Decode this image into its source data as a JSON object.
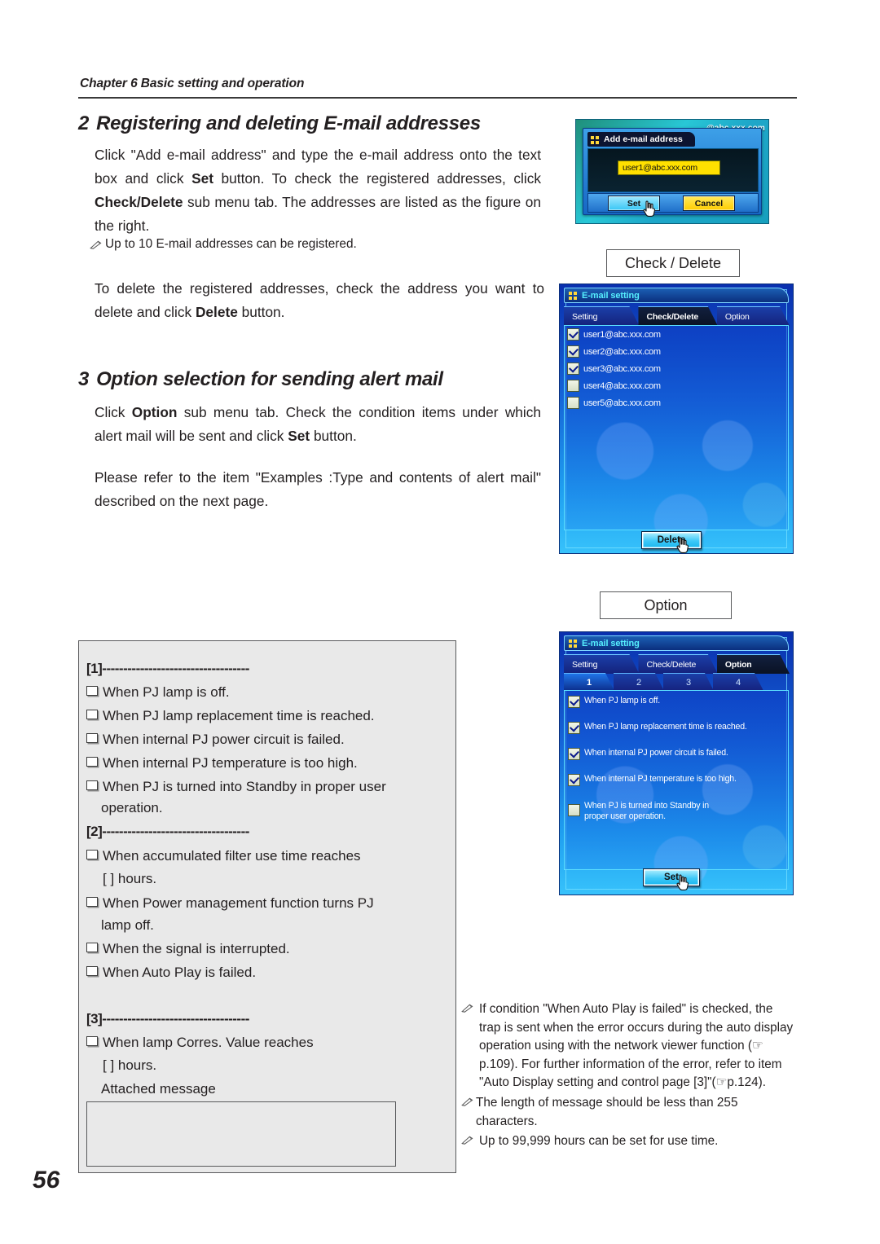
{
  "header": {
    "chapter": "Chapter 6 Basic setting and operation"
  },
  "page_number": "56",
  "sections": [
    {
      "number": "2",
      "title": "Registering and deleting E-mail addresses",
      "paragraph_1": "Click \"Add e-mail address\" and type the e-mail address onto the text box and click Set button. To check the registered addresses, click Check/Delete sub menu tab. The addresses are listed as the figure on the right.",
      "note_1": "Up to 10 E-mail addresses can be registered.",
      "paragraph_2": "To delete the registered addresses, check the address you want to delete and click Delete button."
    },
    {
      "number": "3",
      "title": "Option selection for sending alert mail",
      "paragraph_1": "Click Option sub menu tab. Check the condition items under which alert mail will be sent and click Set button.",
      "paragraph_2": "Please refer to the item \"Examples :Type and contents of alert mail\" described on the next page."
    }
  ],
  "callouts": {
    "check_delete": "Check / Delete",
    "option": "Option"
  },
  "figure_add_email": {
    "background_text": "@abc.xxx.com",
    "dialog_title": "Add e-mail address",
    "input_value": "user1@abc.xxx.com",
    "set_label": "Set",
    "cancel_label": "Cancel"
  },
  "figure_check_delete": {
    "window_title": "E-mail setting",
    "tabs": [
      "Setting",
      "Check/Delete",
      "Option"
    ],
    "active_tab": "Check/Delete",
    "addresses": [
      {
        "email": "user1@abc.xxx.com",
        "checked": true
      },
      {
        "email": "user2@abc.xxx.com",
        "checked": true
      },
      {
        "email": "user3@abc.xxx.com",
        "checked": true
      },
      {
        "email": "user4@abc.xxx.com",
        "checked": false
      },
      {
        "email": "user5@abc.xxx.com",
        "checked": false
      }
    ],
    "delete_label": "Delete"
  },
  "figure_option": {
    "window_title": "E-mail setting",
    "tabs": [
      "Setting",
      "Check/Delete",
      "Option"
    ],
    "active_tab": "Option",
    "subtabs": [
      "1",
      "2",
      "3",
      "4"
    ],
    "active_subtab": "1",
    "conditions": [
      {
        "label": "When PJ lamp is off.",
        "checked": true
      },
      {
        "label": "When PJ lamp replacement time is reached.",
        "checked": true
      },
      {
        "label": "When internal PJ power circuit is failed.",
        "checked": true
      },
      {
        "label": "When internal PJ temperature is too high.",
        "checked": true
      },
      {
        "label": "When PJ is turned into Standby in proper user operation.",
        "checked": false
      }
    ],
    "set_label": "Set"
  },
  "example_box": {
    "group1_marker": "[1]-----------------------------------",
    "group1_items": [
      "When PJ lamp is off.",
      "When PJ lamp replacement time is reached.",
      "When internal PJ power circuit is failed.",
      "When internal PJ temperature is too high.",
      "When PJ is turned into Standby in proper user"
    ],
    "group1_item5_cont": "operation.",
    "group2_marker": "[2]-----------------------------------",
    "group2_item1": "When accumulated filter use time reaches",
    "group2_item1_cont": "[      ] hours.",
    "group2_item2": "When Power management function turns PJ",
    "group2_item2_cont": "lamp off.",
    "group2_item3": "When the signal is interrupted.",
    "group2_item4": "When Auto Play is failed.",
    "group3_marker": "[3]-----------------------------------",
    "group3_item1": "When lamp Corres. Value reaches",
    "group3_item1_cont": "[      ] hours.",
    "attached_message_label": "Attached message"
  },
  "right_notes": [
    "If condition \"When Auto Play is failed\" is checked, the trap is sent when the error occurs during the auto display operation using with the network viewer function (☞p.109). For further information of the error, refer to item \"Auto Display setting and control page [3]\"(☞p.124).",
    "The length of message should be less than 255 characters.",
    "Up to 99,999 hours can be set for use time."
  ],
  "colors": {
    "text": "#231f20",
    "rule": "#3a3a3a",
    "box_border": "#58595b",
    "box_fill": "#e9e9e9",
    "ui_blue": "#1565d8",
    "ui_cyan": "#56f0ff",
    "ui_yellow": "#ffe000"
  }
}
